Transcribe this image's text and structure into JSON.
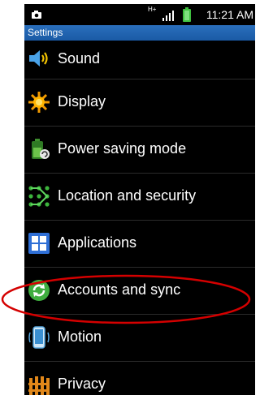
{
  "status_bar": {
    "network_type": "H+",
    "time": "11:21 AM",
    "icons": [
      "camera-icon",
      "hplus-icon",
      "signal-icon",
      "battery-icon"
    ]
  },
  "title_bar": {
    "title": "Settings"
  },
  "settings_items": [
    {
      "label": "Sound",
      "icon": "speaker-icon"
    },
    {
      "label": "Display",
      "icon": "display-icon"
    },
    {
      "label": "Power saving mode",
      "icon": "battery-recycle-icon"
    },
    {
      "label": "Location and security",
      "icon": "location-grid-icon"
    },
    {
      "label": "Applications",
      "icon": "applications-icon"
    },
    {
      "label": "Accounts and sync",
      "icon": "sync-icon",
      "highlighted": true
    },
    {
      "label": "Motion",
      "icon": "phone-motion-icon"
    },
    {
      "label": "Privacy",
      "icon": "privacy-fence-icon"
    }
  ],
  "colors": {
    "title_bar": "#1f63b0",
    "highlight": "#d40000",
    "background": "#000000"
  }
}
